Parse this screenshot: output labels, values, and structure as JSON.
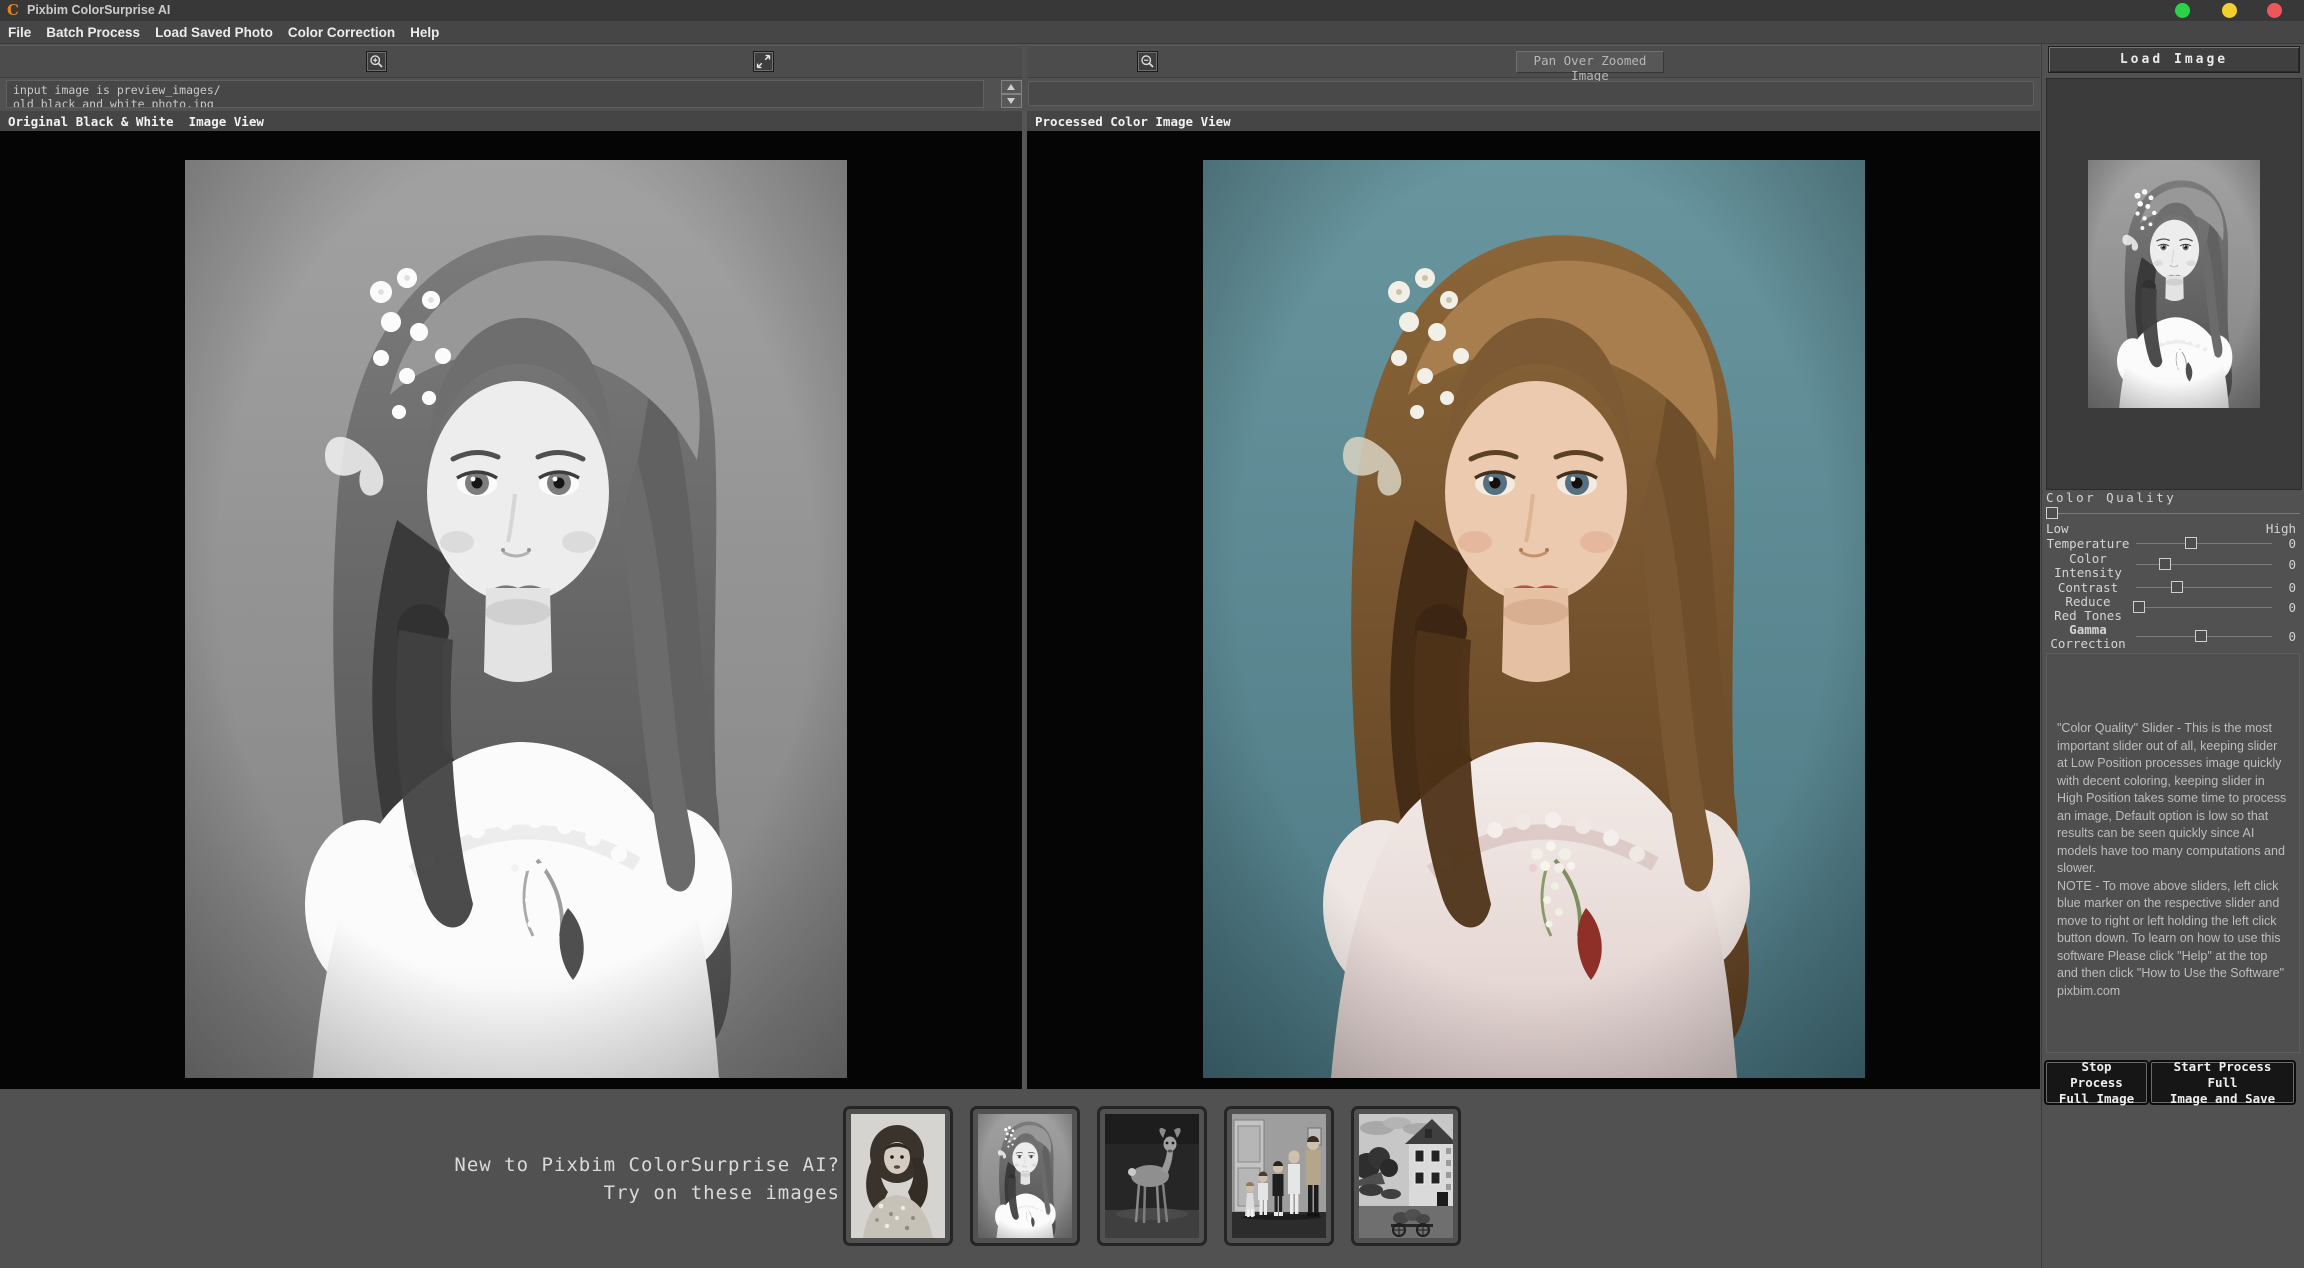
{
  "title_bar": {
    "logo_glyph": "C",
    "title": "Pixbim ColorSurprise AI",
    "control_colors": {
      "green": "#2bd14a",
      "yellow": "#f2d12d",
      "red": "#ee5757"
    }
  },
  "menu": {
    "items": [
      "File",
      "Batch Process",
      "Load Saved Photo",
      "Color Correction",
      "Help"
    ]
  },
  "toolbar": {
    "pan_button_label": "Pan Over Zoomed Image",
    "icons": [
      "magnifier-plus",
      "diagonal-expand-arrows",
      "magnifier-minus",
      "spinner-up-triangle",
      "spinner-down-triangle"
    ]
  },
  "input_info": {
    "line1": "input image is preview_images/",
    "line2": "old black and white photo.jpg"
  },
  "panels": {
    "left_header": "Original Black & White  Image View",
    "right_header": "Processed Color Image View"
  },
  "sidebar": {
    "load_button_label": "Load Image",
    "color_quality": {
      "heading": "Color Quality",
      "low_label": "Low",
      "high_label": "High",
      "sliders": [
        {
          "line1": "Temperature",
          "line2": "",
          "value": "0"
        },
        {
          "line1": "Color",
          "line2": "Intensity",
          "value": "0"
        },
        {
          "line1": "Contrast",
          "line2": "",
          "value": "0"
        },
        {
          "line1": "Reduce",
          "line2": "Red Tones",
          "value": "0"
        },
        {
          "line1": "Gamma",
          "line2": "Correction",
          "value": "0"
        }
      ]
    },
    "help_text": "\"Color Quality\" Slider - This is the most important slider out of all, keeping slider at Low Position processes image quickly with decent coloring, keeping slider in High Position takes some time to process an image, Default option is low so that results can be seen quickly since AI models have too many computations and slower.\nNOTE - To move above sliders, left click blue marker on the respective slider and move to right or left holding the left click button down. To learn on how to use this software Please click \"Help\" at the top and then click \"How to Use the Software\"\npixbim.com",
    "stop_button": "Stop Process\nFull Image",
    "start_button": "Start Process Full\nImage and Save"
  },
  "promo": {
    "line1": "New to Pixbim ColorSurprise AI?",
    "line2": "Try on these images"
  },
  "thumbnails": [
    "vintage-woman-portrait",
    "vintage-girl-portrait",
    "deer",
    "family-group",
    "old-farmhouse"
  ]
}
